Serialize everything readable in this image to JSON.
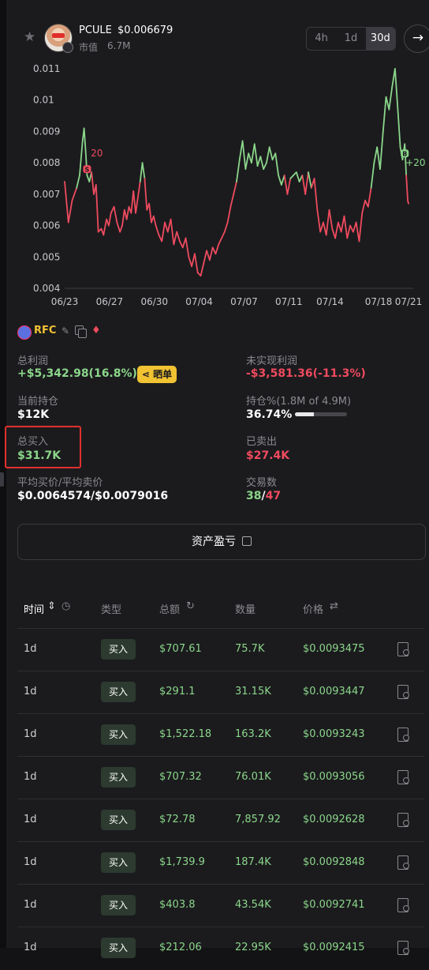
{
  "header": {
    "token_name": "PCULE",
    "token_price": "$0.006679",
    "market_cap_label": "市值",
    "market_cap_value": "6.7M",
    "timeframes": [
      "4h",
      "1d",
      "30d"
    ],
    "active_timeframe": "30d"
  },
  "chart_data": {
    "type": "line",
    "x_tick_labels": [
      "06/23",
      "06/27",
      "06/30",
      "07/04",
      "07/07",
      "07/11",
      "07/14",
      "07/18",
      "07/21"
    ],
    "y_tick_labels": [
      "0.011",
      "0.01",
      "0.009",
      "0.008",
      "0.007",
      "0.006",
      "0.005",
      "0.004"
    ],
    "ylim": [
      0.004,
      0.011
    ],
    "colors": {
      "above": "#8bd68a",
      "below": "#ef4b5e"
    },
    "threshold": 0.0074,
    "x": [
      0,
      1,
      2,
      3,
      4,
      5,
      6,
      7,
      8,
      9,
      10,
      11,
      12,
      13,
      14,
      15,
      16,
      17,
      18,
      19,
      20,
      21,
      22,
      23,
      24,
      25,
      26,
      27,
      28,
      29,
      30,
      31,
      32,
      33,
      34,
      35,
      36,
      37,
      38,
      39,
      40,
      41,
      42,
      43,
      44,
      45,
      46,
      47,
      48,
      49,
      50,
      51,
      52,
      53,
      54,
      55,
      56,
      57,
      58,
      59,
      60,
      61,
      62,
      63,
      64,
      65,
      66,
      67,
      68,
      69,
      70,
      71,
      72,
      73,
      74,
      75,
      76,
      77,
      78,
      79,
      80,
      81,
      82,
      83,
      84,
      85,
      86,
      87,
      88,
      89,
      90,
      91,
      92,
      93,
      94,
      95,
      96,
      97,
      98,
      99,
      100,
      101,
      102,
      103,
      104,
      105,
      106,
      107,
      108,
      109,
      110,
      111,
      112,
      113,
      114,
      115,
      116,
      117,
      118,
      119,
      120,
      121,
      122,
      123,
      124,
      125,
      126,
      127,
      128,
      129,
      130,
      131,
      132,
      133,
      134,
      135,
      136,
      137,
      138,
      139,
      140,
      141,
      142,
      143,
      144,
      145,
      146,
      147,
      148,
      149,
      150,
      151,
      152,
      153,
      154,
      155,
      156,
      157,
      158,
      159,
      160,
      161,
      162,
      163,
      164,
      165,
      166,
      167,
      168,
      169,
      170,
      171,
      172,
      173,
      174,
      175,
      176,
      177,
      178,
      179,
      180,
      181,
      182,
      183,
      184,
      185,
      186,
      187,
      188,
      189,
      190,
      191,
      192,
      193,
      194,
      195,
      196,
      197,
      198,
      199,
      200,
      201,
      202,
      203,
      204,
      205,
      206,
      207,
      208,
      209,
      210,
      211,
      212,
      213,
      214,
      215,
      216,
      217,
      218,
      219,
      220,
      221,
      222,
      223,
      224,
      225,
      226,
      227,
      228,
      229,
      230,
      231,
      232,
      233,
      234,
      235,
      236,
      237,
      238,
      239,
      240,
      241,
      242,
      243,
      244,
      245,
      246,
      247,
      248,
      249,
      250,
      251,
      252,
      253,
      254,
      255,
      256,
      257,
      258,
      259,
      260,
      261,
      262,
      263,
      264,
      265,
      266,
      267,
      268,
      269,
      270,
      271,
      272,
      273,
      274,
      275,
      276,
      277,
      278,
      279,
      280,
      281,
      282,
      283,
      284,
      285,
      286,
      287,
      288,
      289,
      290,
      291,
      292,
      293,
      294,
      295,
      296,
      297,
      298,
      299,
      300,
      301,
      302,
      303,
      304,
      305,
      306,
      307,
      308,
      309,
      310,
      311,
      312,
      313,
      314,
      315,
      316,
      317,
      318,
      319,
      320,
      321,
      322,
      323,
      324,
      325,
      326,
      327,
      328,
      329,
      330,
      331,
      332,
      333,
      334,
      335,
      336,
      337,
      338,
      339,
      340,
      341,
      342,
      343,
      344,
      345,
      346,
      347,
      348,
      349,
      350,
      351,
      352,
      353,
      354,
      355,
      356,
      357,
      358,
      359,
      360,
      361,
      362,
      363,
      364,
      365,
      366,
      367,
      368,
      369,
      370,
      371,
      372,
      373,
      374,
      375,
      376,
      377,
      378,
      379,
      380,
      381,
      382,
      383,
      384,
      385,
      386,
      387,
      388,
      389,
      390,
      391,
      392,
      393,
      394,
      395,
      396,
      397,
      398,
      399,
      400,
      401,
      402,
      403,
      404,
      405,
      406,
      407,
      408,
      409,
      410,
      411,
      412,
      413,
      414,
      415,
      416,
      417,
      418,
      419,
      420,
      421,
      422,
      423,
      424,
      425,
      426,
      427,
      428,
      429,
      430,
      431,
      432,
      433,
      434,
      435,
      436,
      437,
      438,
      439,
      440,
      441,
      442,
      443,
      444,
      445,
      446,
      447,
      448,
      449,
      450,
      451,
      452,
      453,
      454,
      455,
      456,
      457,
      458,
      459,
      460
    ],
    "y_points": [
      [
        0,
        0.0074
      ],
      [
        5,
        0.0061
      ],
      [
        10,
        0.0068
      ],
      [
        16,
        0.0072
      ],
      [
        20,
        0.0076
      ],
      [
        24,
        0.0087
      ],
      [
        26,
        0.0091
      ],
      [
        28,
        0.0084
      ],
      [
        30,
        0.0076
      ],
      [
        33,
        0.0074
      ],
      [
        36,
        0.0077
      ],
      [
        39,
        0.007
      ],
      [
        42,
        0.0073
      ],
      [
        45,
        0.0058
      ],
      [
        49,
        0.0059
      ],
      [
        52,
        0.0057
      ],
      [
        56,
        0.0062
      ],
      [
        59,
        0.006
      ],
      [
        62,
        0.0064
      ],
      [
        66,
        0.0066
      ],
      [
        70,
        0.0061
      ],
      [
        74,
        0.0058
      ],
      [
        77,
        0.006
      ],
      [
        80,
        0.0065
      ],
      [
        83,
        0.0062
      ],
      [
        86,
        0.0066
      ],
      [
        89,
        0.0064
      ],
      [
        92,
        0.0071
      ],
      [
        95,
        0.0064
      ],
      [
        98,
        0.0069
      ],
      [
        101,
        0.0074
      ],
      [
        104,
        0.008
      ],
      [
        107,
        0.0075
      ],
      [
        110,
        0.0065
      ],
      [
        113,
        0.0067
      ],
      [
        116,
        0.0061
      ],
      [
        119,
        0.0063
      ],
      [
        122,
        0.006
      ],
      [
        126,
        0.0057
      ],
      [
        130,
        0.0055
      ],
      [
        134,
        0.0061
      ],
      [
        138,
        0.0058
      ],
      [
        142,
        0.0062
      ],
      [
        146,
        0.0054
      ],
      [
        150,
        0.0058
      ],
      [
        154,
        0.0055
      ],
      [
        158,
        0.0053
      ],
      [
        162,
        0.0056
      ],
      [
        166,
        0.005
      ],
      [
        170,
        0.0047
      ],
      [
        174,
        0.0051
      ],
      [
        178,
        0.0045
      ],
      [
        182,
        0.0044
      ],
      [
        186,
        0.0048
      ],
      [
        190,
        0.0052
      ],
      [
        194,
        0.0049
      ],
      [
        198,
        0.0053
      ],
      [
        202,
        0.0051
      ],
      [
        206,
        0.0054
      ],
      [
        210,
        0.0056
      ],
      [
        214,
        0.0058
      ],
      [
        218,
        0.0061
      ],
      [
        222,
        0.0066
      ],
      [
        226,
        0.007
      ],
      [
        230,
        0.0074
      ],
      [
        234,
        0.0081
      ],
      [
        238,
        0.0087
      ],
      [
        242,
        0.0078
      ],
      [
        246,
        0.0083
      ],
      [
        250,
        0.008
      ],
      [
        254,
        0.0086
      ],
      [
        258,
        0.0079
      ],
      [
        262,
        0.0082
      ],
      [
        266,
        0.0078
      ],
      [
        270,
        0.008
      ],
      [
        274,
        0.0085
      ],
      [
        278,
        0.0081
      ],
      [
        282,
        0.0083
      ],
      [
        286,
        0.0076
      ],
      [
        290,
        0.0073
      ],
      [
        294,
        0.0076
      ],
      [
        298,
        0.007
      ],
      [
        302,
        0.0075
      ],
      [
        306,
        0.0076
      ],
      [
        310,
        0.0077
      ],
      [
        314,
        0.0074
      ],
      [
        318,
        0.0076
      ],
      [
        322,
        0.007
      ],
      [
        326,
        0.0077
      ],
      [
        330,
        0.0072
      ],
      [
        334,
        0.0075
      ],
      [
        338,
        0.0065
      ],
      [
        342,
        0.0058
      ],
      [
        346,
        0.0061
      ],
      [
        350,
        0.0057
      ],
      [
        354,
        0.0065
      ],
      [
        358,
        0.0059
      ],
      [
        362,
        0.0056
      ],
      [
        366,
        0.0061
      ],
      [
        370,
        0.0058
      ],
      [
        374,
        0.0063
      ],
      [
        378,
        0.0056
      ],
      [
        382,
        0.006
      ],
      [
        386,
        0.0058
      ],
      [
        390,
        0.0061
      ],
      [
        394,
        0.0055
      ],
      [
        398,
        0.0064
      ],
      [
        402,
        0.0068
      ],
      [
        406,
        0.0066
      ],
      [
        410,
        0.0072
      ],
      [
        414,
        0.008
      ],
      [
        418,
        0.0085
      ],
      [
        422,
        0.0078
      ],
      [
        426,
        0.009
      ],
      [
        430,
        0.0101
      ],
      [
        434,
        0.0097
      ],
      [
        438,
        0.0104
      ],
      [
        442,
        0.011
      ],
      [
        446,
        0.0096
      ],
      [
        449,
        0.0085
      ],
      [
        452,
        0.0081
      ],
      [
        455,
        0.0086
      ],
      [
        457,
        0.0076
      ],
      [
        459,
        0.0068
      ],
      [
        460,
        0.0067
      ]
    ],
    "markers": [
      {
        "label": "S",
        "x": 30,
        "y": 0.0078,
        "kind": "sell"
      },
      {
        "label": "B",
        "x": 455,
        "y": 0.0083,
        "kind": "buy"
      }
    ],
    "annotations": [
      {
        "text": "20",
        "x": 35,
        "y": 0.0082
      },
      {
        "text": "+20",
        "x": 456,
        "y": 0.0079
      }
    ]
  },
  "wallet": {
    "name": "RFC"
  },
  "stats": {
    "total_profit_label": "总利润",
    "total_profit_value": "+$5,342.98(16.8%)",
    "share_label": "晒单",
    "unrealized_label": "未实现利润",
    "unrealized_value": "-$3,581.36(-11.3%)",
    "holding_label": "当前持仓",
    "holding_value": "$12K",
    "holding_pct_label": "持仓%(1.8M of 4.9M)",
    "holding_pct_value": "36.74%",
    "holding_pct_fraction": 0.3674,
    "total_buy_label": "总买入",
    "total_buy_value": "$31.7K",
    "sold_label": "已卖出",
    "sold_value": "$27.4K",
    "avg_label": "平均买价/平均卖价",
    "avg_value": "$0.0064574/$0.0079016",
    "trades_label": "交易数",
    "trades_buy": "38",
    "trades_sep": "/",
    "trades_sell": "47"
  },
  "asset_button_label": "资产盈亏",
  "table": {
    "headers": {
      "time": "时间",
      "type": "类型",
      "amount": "总额",
      "qty": "数量",
      "price": "价格"
    },
    "rows": [
      {
        "time": "1d",
        "type": "买入",
        "amount": "$707.61",
        "qty": "75.7K",
        "price": "$0.0093475"
      },
      {
        "time": "1d",
        "type": "买入",
        "amount": "$291.1",
        "qty": "31.15K",
        "price": "$0.0093447"
      },
      {
        "time": "1d",
        "type": "买入",
        "amount": "$1,522.18",
        "qty": "163.2K",
        "price": "$0.0093243"
      },
      {
        "time": "1d",
        "type": "买入",
        "amount": "$707.32",
        "qty": "76.01K",
        "price": "$0.0093056"
      },
      {
        "time": "1d",
        "type": "买入",
        "amount": "$72.78",
        "qty": "7,857.92",
        "price": "$0.0092628"
      },
      {
        "time": "1d",
        "type": "买入",
        "amount": "$1,739.9",
        "qty": "187.4K",
        "price": "$0.0092848"
      },
      {
        "time": "1d",
        "type": "买入",
        "amount": "$403.8",
        "qty": "43.54K",
        "price": "$0.0092741"
      },
      {
        "time": "1d",
        "type": "买入",
        "amount": "$212.06",
        "qty": "22.95K",
        "price": "$0.0092415"
      }
    ]
  }
}
